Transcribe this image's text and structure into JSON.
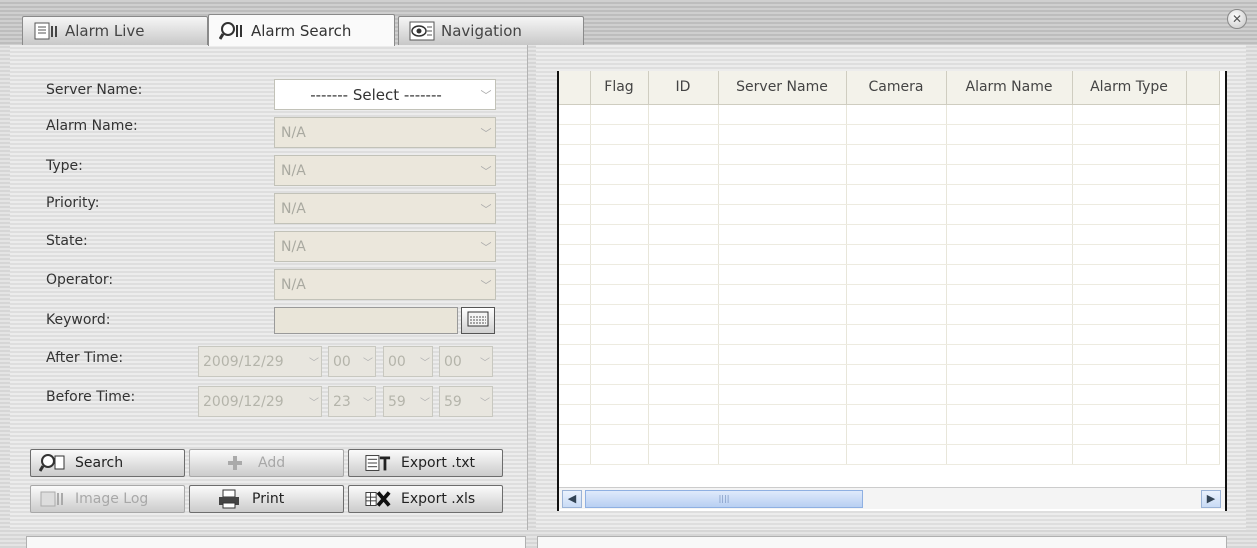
{
  "tabs": [
    {
      "label": "Alarm Live",
      "active": false
    },
    {
      "label": "Alarm Search",
      "active": true
    },
    {
      "label": "Navigation",
      "active": false
    }
  ],
  "close_label": "✕",
  "form": {
    "server_name": {
      "label": "Server Name:",
      "value": "-------    Select    -------"
    },
    "alarm_name": {
      "label": "Alarm Name:",
      "value": "N/A"
    },
    "type": {
      "label": "Type:",
      "value": "N/A"
    },
    "priority": {
      "label": "Priority:",
      "value": "N/A"
    },
    "state": {
      "label": "State:",
      "value": "N/A"
    },
    "operator": {
      "label": "Operator:",
      "value": "N/A"
    },
    "keyword": {
      "label": "Keyword:",
      "value": ""
    },
    "after_time": {
      "label": "After Time:",
      "date": "2009/12/29",
      "hh": "00",
      "mm": "00",
      "ss": "00"
    },
    "before_time": {
      "label": "Before Time:",
      "date": "2009/12/29",
      "hh": "23",
      "mm": "59",
      "ss": "59"
    }
  },
  "buttons": {
    "search": "Search",
    "add": "Add",
    "export_txt": "Export .txt",
    "image_log": "Image Log",
    "print": "Print",
    "export_xls": "Export .xls"
  },
  "table": {
    "columns": [
      "Flag",
      "ID",
      "Server Name",
      "Camera",
      "Alarm Name",
      "Alarm Type"
    ],
    "rows": []
  },
  "scroll_grip": "||||"
}
